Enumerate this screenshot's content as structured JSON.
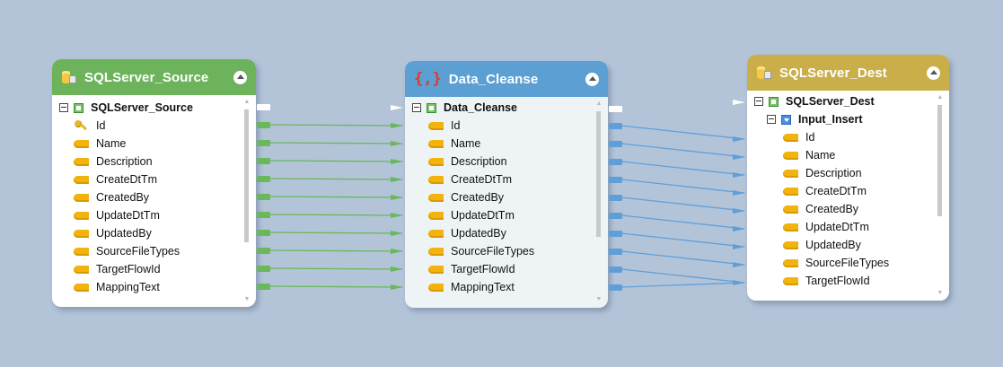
{
  "nodes": {
    "source": {
      "title": "SQLServer_Source",
      "header_color": "#6cb35c",
      "tree_root": "SQLServer_Source",
      "columns": [
        {
          "name": "Id",
          "key": true
        },
        {
          "name": "Name"
        },
        {
          "name": "Description"
        },
        {
          "name": "CreateDtTm"
        },
        {
          "name": "CreatedBy"
        },
        {
          "name": "UpdateDtTm"
        },
        {
          "name": "UpdatedBy"
        },
        {
          "name": "SourceFileTypes"
        },
        {
          "name": "TargetFlowId"
        },
        {
          "name": "MappingText"
        }
      ]
    },
    "cleanse": {
      "title": "Data_Cleanse",
      "header_color": "#5b9fd3",
      "tree_root": "Data_Cleanse",
      "columns": [
        {
          "name": "Id"
        },
        {
          "name": "Name"
        },
        {
          "name": "Description"
        },
        {
          "name": "CreateDtTm"
        },
        {
          "name": "CreatedBy"
        },
        {
          "name": "UpdateDtTm"
        },
        {
          "name": "UpdatedBy"
        },
        {
          "name": "SourceFileTypes"
        },
        {
          "name": "TargetFlowId"
        },
        {
          "name": "MappingText"
        }
      ]
    },
    "dest": {
      "title": "SQLServer_Dest",
      "header_color": "#c9ae4a",
      "tree_root": "SQLServer_Dest",
      "sub_root": "Input_Insert",
      "columns": [
        {
          "name": "Id"
        },
        {
          "name": "Name"
        },
        {
          "name": "Description"
        },
        {
          "name": "CreateDtTm"
        },
        {
          "name": "CreatedBy"
        },
        {
          "name": "UpdateDtTm"
        },
        {
          "name": "UpdatedBy"
        },
        {
          "name": "SourceFileTypes"
        },
        {
          "name": "TargetFlowId"
        }
      ]
    }
  },
  "link_colors": {
    "source_to_cleanse": "#69b85a",
    "cleanse_to_dest": "#5f9fd9"
  }
}
